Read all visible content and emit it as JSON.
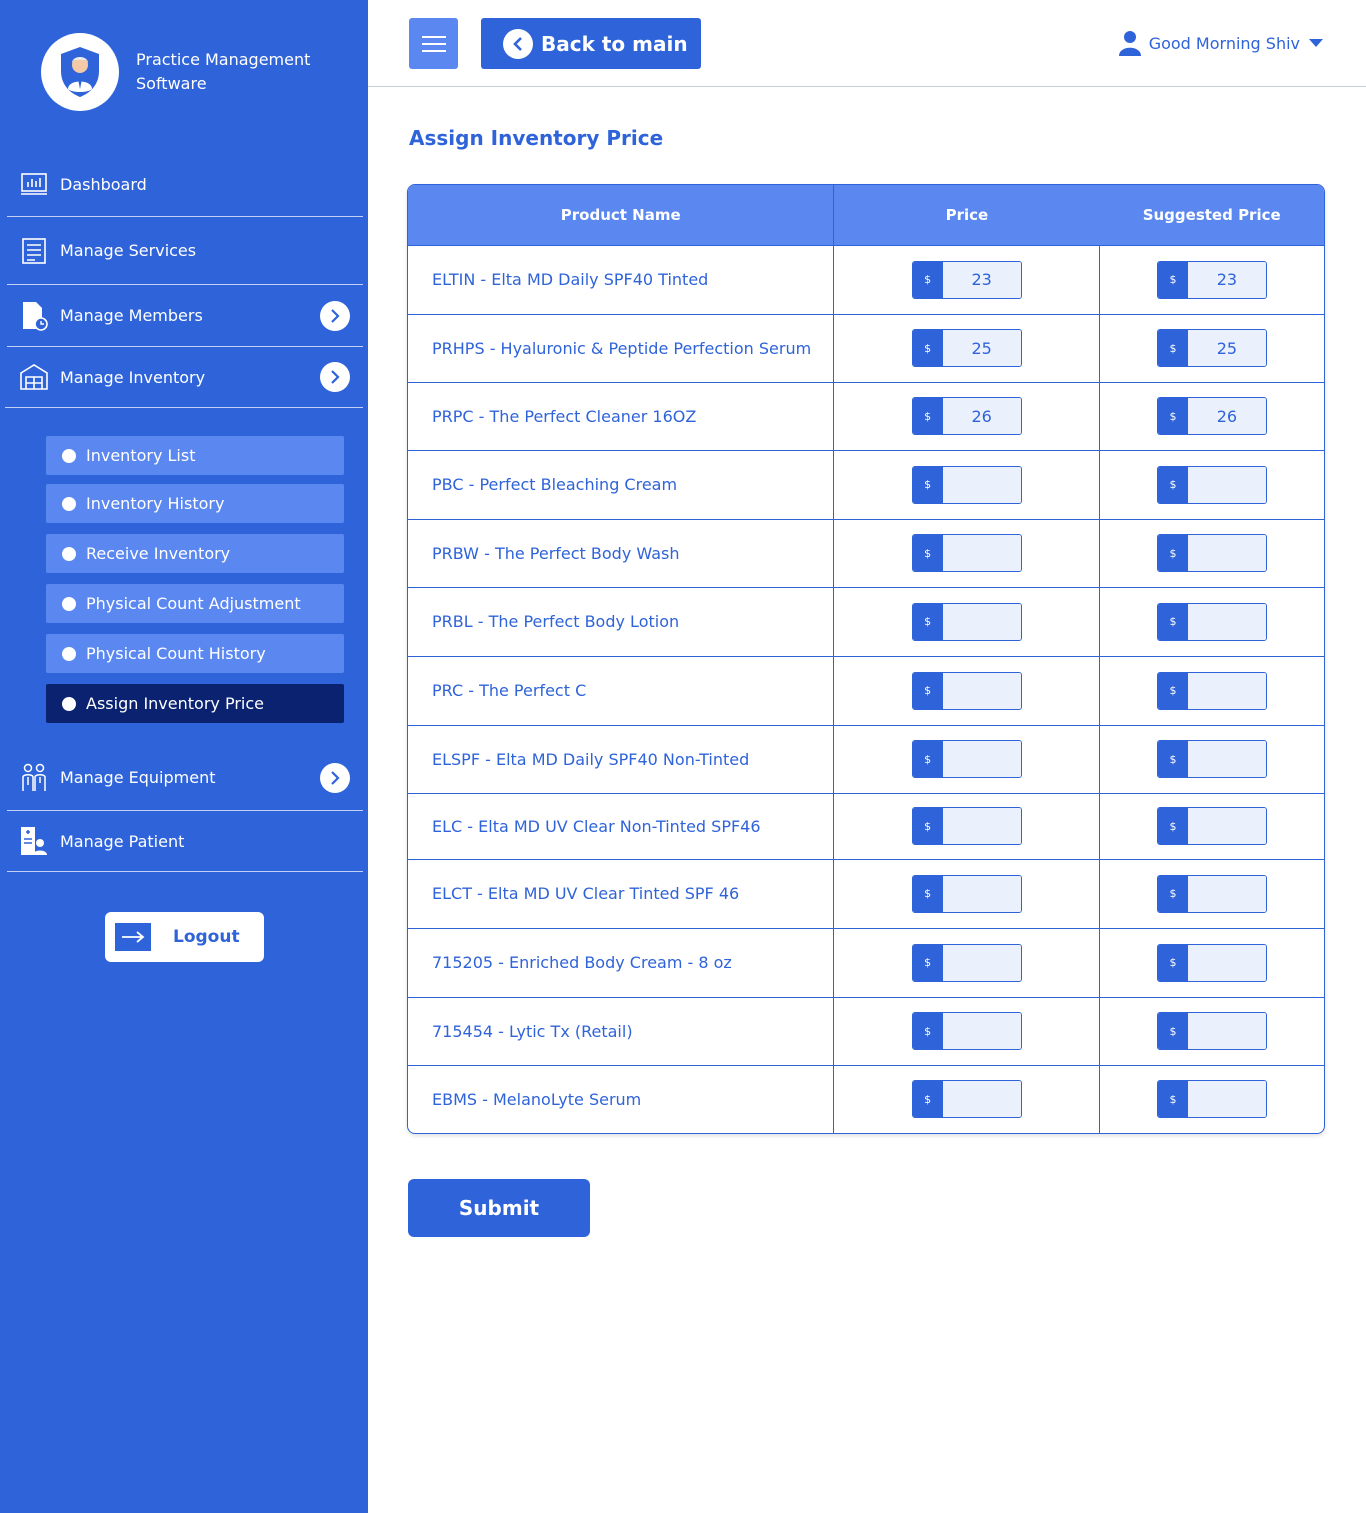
{
  "brand": {
    "line1": "Practice Management",
    "line2": "Software"
  },
  "sidebar": {
    "nav": [
      {
        "label": "Dashboard"
      },
      {
        "label": "Manage Services"
      },
      {
        "label": "Manage Members"
      },
      {
        "label": "Manage Inventory"
      }
    ],
    "sub_items": [
      {
        "label": "Inventory List"
      },
      {
        "label": "Inventory History"
      },
      {
        "label": "Receive Inventory"
      },
      {
        "label": "Physical Count Adjustment"
      },
      {
        "label": "Physical Count History"
      },
      {
        "label": "Assign Inventory Price"
      }
    ],
    "nav_bottom": [
      {
        "label": "Manage Equipment"
      },
      {
        "label": "Manage Patient"
      }
    ],
    "logout_label": "Logout"
  },
  "header": {
    "back_label": "Back to main",
    "greeting": "Good Morning Shiv"
  },
  "main": {
    "title": "Assign Inventory Price",
    "columns": [
      "Product Name",
      "Price",
      "Suggested Price"
    ],
    "currency": "$",
    "rows": [
      {
        "name": "ELTIN - Elta MD Daily SPF40 Tinted",
        "price": "23",
        "suggested": "23"
      },
      {
        "name": "PRHPS - Hyaluronic & Peptide Perfection Serum",
        "price": "25",
        "suggested": "25"
      },
      {
        "name": "PRPC - The Perfect Cleaner 16OZ",
        "price": "26",
        "suggested": "26"
      },
      {
        "name": "PBC - Perfect Bleaching Cream",
        "price": "",
        "suggested": ""
      },
      {
        "name": "PRBW - The Perfect Body Wash",
        "price": "",
        "suggested": ""
      },
      {
        "name": "PRBL - The Perfect Body Lotion",
        "price": "",
        "suggested": ""
      },
      {
        "name": "PRC - The Perfect C",
        "price": "",
        "suggested": ""
      },
      {
        "name": "ELSPF - Elta MD Daily SPF40 Non-Tinted",
        "price": "",
        "suggested": ""
      },
      {
        "name": "ELC - Elta MD UV Clear Non-Tinted SPF46",
        "price": "",
        "suggested": ""
      },
      {
        "name": "ELCT - Elta MD UV Clear Tinted SPF 46",
        "price": "",
        "suggested": ""
      },
      {
        "name": "715205 - Enriched Body Cream - 8 oz",
        "price": "",
        "suggested": ""
      },
      {
        "name": "715454 - Lytic Tx (Retail)",
        "price": "",
        "suggested": ""
      },
      {
        "name": "EBMS - MelanoLyte Serum",
        "price": "",
        "suggested": ""
      }
    ],
    "submit_label": "Submit"
  }
}
